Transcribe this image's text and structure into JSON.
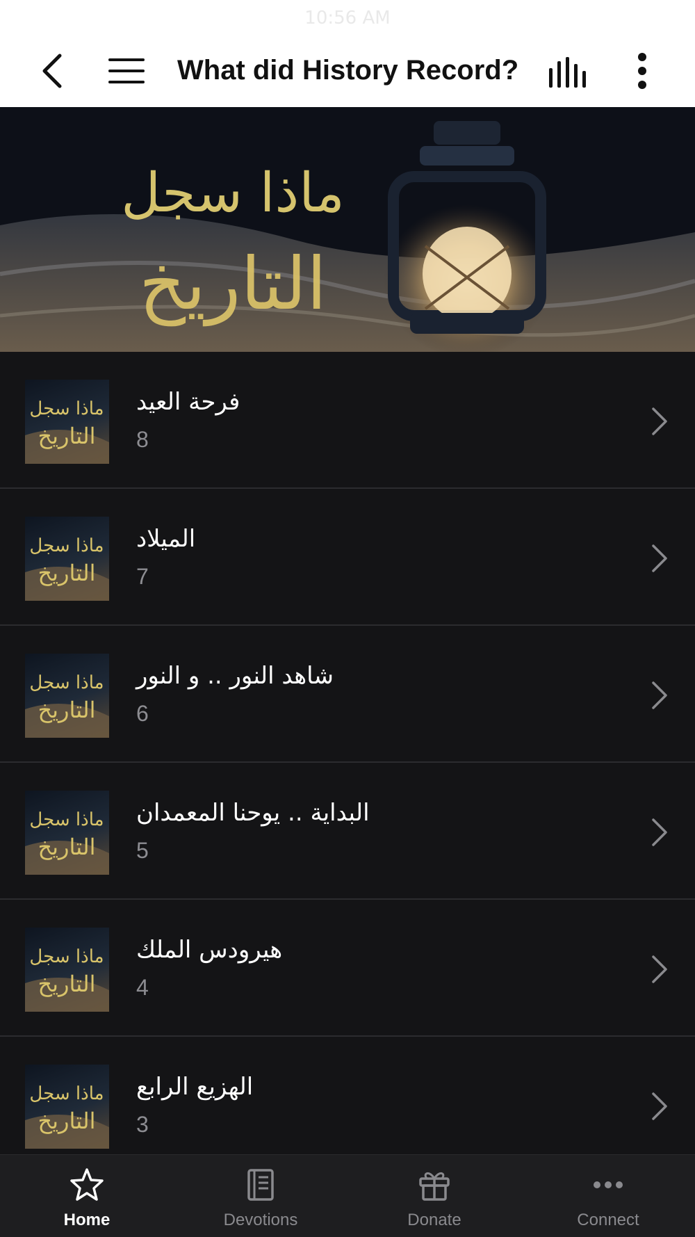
{
  "status_bar": {
    "time": "10:56 AM"
  },
  "header": {
    "title": "What did History Record?"
  },
  "hero": {
    "lettering": "ماذا سجل التاريخ"
  },
  "episodes": [
    {
      "title": "فرحة العيد",
      "count": "8"
    },
    {
      "title": "الميلاد",
      "count": "7"
    },
    {
      "title": "شاهد النور .. و النور",
      "count": "6"
    },
    {
      "title": "البداية .. يوحنا المعمدان",
      "count": "5"
    },
    {
      "title": "هيرودس الملك",
      "count": "4"
    },
    {
      "title": "الهزيع الرابع",
      "count": "3"
    }
  ],
  "tabs": [
    {
      "label": "Home",
      "icon": "star-icon",
      "active": true
    },
    {
      "label": "Devotions",
      "icon": "book-icon",
      "active": false
    },
    {
      "label": "Donate",
      "icon": "gift-icon",
      "active": false
    },
    {
      "label": "Connect",
      "icon": "dots-icon",
      "active": false
    }
  ],
  "colors": {
    "accent_gold": "#d9c46a",
    "background": "#131315",
    "tabbar": "#1e1e20"
  }
}
